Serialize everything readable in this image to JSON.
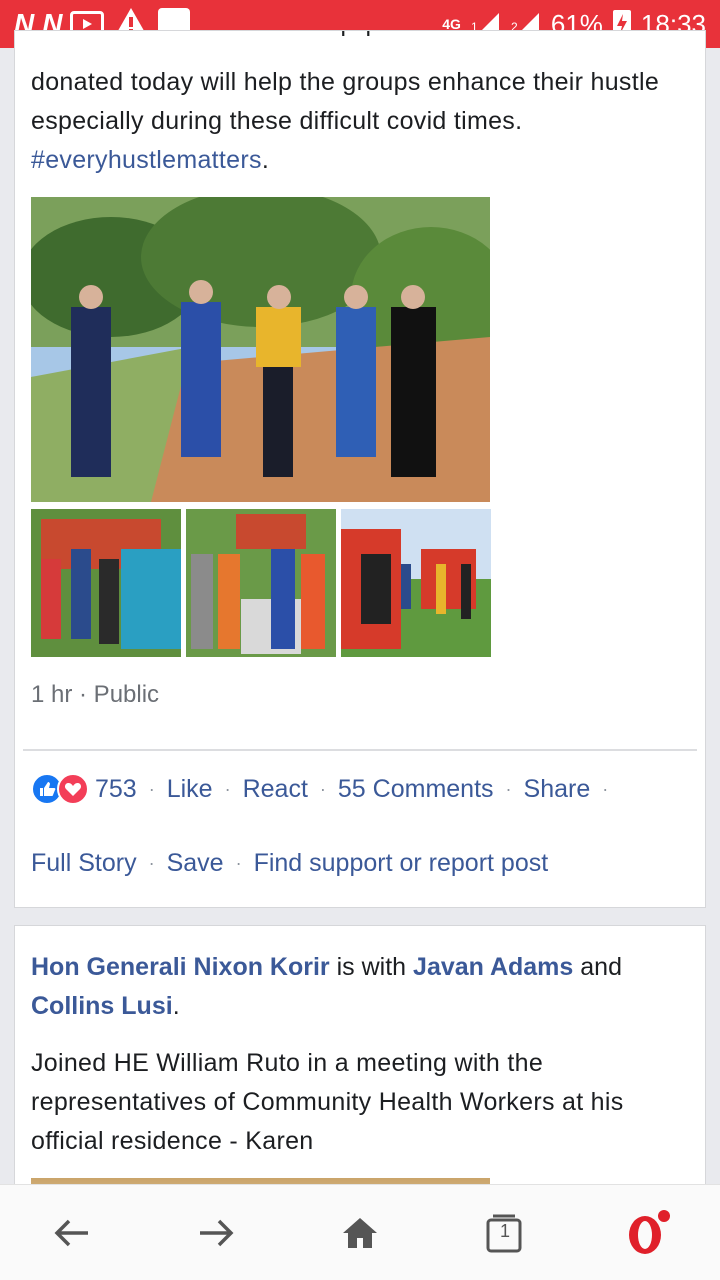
{
  "status": {
    "left_icons": [
      "news-app-icon",
      "news-app-icon",
      "youtube-icon",
      "warning-icon",
      "notification-icon"
    ],
    "network": "4G",
    "battery": "61%",
    "time": "18:33"
  },
  "post1": {
    "clipped_text": "Kibra constituencies. The equipment and items",
    "body": "donated today will help the groups enhance their hustle especially during these difficult covid times.",
    "hashtag": "#everyhustlematters",
    "hashtag_suffix": ".",
    "meta": "1 hr · Public",
    "reaction_count": "753",
    "actions": [
      "Like",
      "React",
      "55 Comments",
      "Share"
    ],
    "actions2": [
      "Full Story",
      "Save",
      "Find support or report post"
    ]
  },
  "post2": {
    "author": "Hon Generali Nixon Korir",
    "with_text": "is with",
    "tag1": "Javan Adams",
    "and_text": "and",
    "tag2": "Collins Lusi",
    "period": ".",
    "body": "Joined HE William Ruto in a meeting with the representatives of Community Health Workers at his official residence - Karen"
  },
  "nav": {
    "tabs_count": "1",
    "icons": [
      "back-arrow-icon",
      "forward-arrow-icon",
      "home-icon",
      "tabs-icon",
      "opera-icon"
    ]
  },
  "colors": {
    "status_bar": "#e8323a",
    "link": "#3b5998",
    "like": "#1877f2",
    "love": "#f33e58"
  }
}
